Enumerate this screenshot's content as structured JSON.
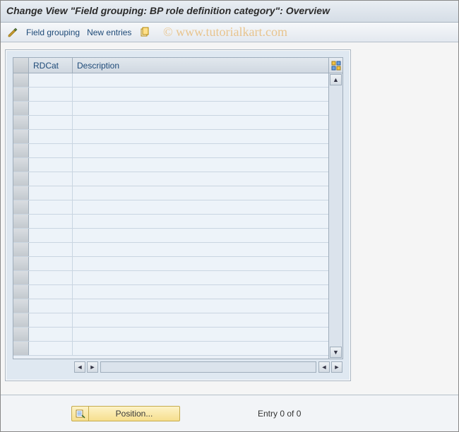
{
  "title": "Change View \"Field grouping: BP role definition category\": Overview",
  "watermark": "© www.tutorialkart.com",
  "toolbar": {
    "field_grouping": "Field grouping",
    "new_entries": "New entries"
  },
  "grid": {
    "columns": {
      "rdcat": "RDCat",
      "description": "Description"
    },
    "rows": [
      {},
      {},
      {},
      {},
      {},
      {},
      {},
      {},
      {},
      {},
      {},
      {},
      {},
      {},
      {},
      {},
      {},
      {},
      {},
      {}
    ]
  },
  "footer": {
    "position_label": "Position...",
    "entry_text": "Entry 0 of 0"
  }
}
